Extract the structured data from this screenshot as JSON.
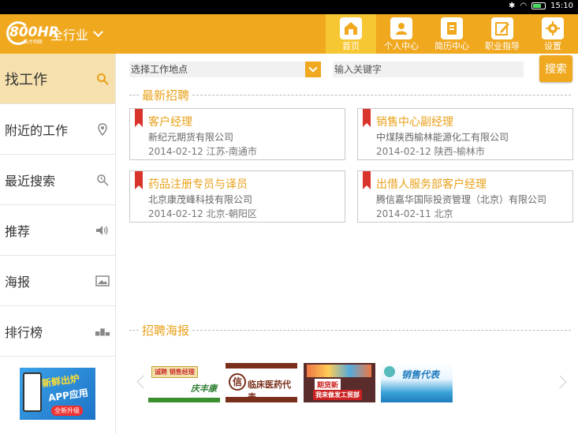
{
  "status": {
    "time": "15:10"
  },
  "header": {
    "logo_number": "800HR",
    "logo_sub": "英才网联",
    "industry": "全行业",
    "nav": [
      {
        "label": "首页",
        "icon": "home-icon"
      },
      {
        "label": "个人中心",
        "icon": "person-icon"
      },
      {
        "label": "简历中心",
        "icon": "resume-icon"
      },
      {
        "label": "职业指导",
        "icon": "edit-icon"
      },
      {
        "label": "设置",
        "icon": "gear-icon"
      }
    ]
  },
  "sidebar": {
    "items": [
      {
        "label": "找工作",
        "icon": "search-icon"
      },
      {
        "label": "附近的工作",
        "icon": "location-pin-icon"
      },
      {
        "label": "最近搜索",
        "icon": "recent-search-icon"
      },
      {
        "label": "推荐",
        "icon": "speaker-icon"
      },
      {
        "label": "海报",
        "icon": "poster-icon"
      },
      {
        "label": "排行榜",
        "icon": "podium-icon"
      }
    ],
    "ad": {
      "line1": "新鲜出炉",
      "line2": "APP应用",
      "badge": "全新升级"
    }
  },
  "search": {
    "location_label": "选择工作地点",
    "keyword_placeholder": "输入关键字",
    "button_label": "搜索"
  },
  "latest": {
    "title": "最新招聘",
    "jobs": [
      {
        "title": "客户经理",
        "company": "新纪元期货有限公司",
        "date": "2014-02-12",
        "location": "江苏-南通市"
      },
      {
        "title": "销售中心副经理",
        "company": "中煤陕西榆林能源化工有限公司",
        "date": "2014-02-12",
        "location": "陕西-榆林市"
      },
      {
        "title": "药品注册专员与译员",
        "company": "北京康茂峰科技有限公司",
        "date": "2014-02-12",
        "location": "北京-朝阳区"
      },
      {
        "title": "出借人服务部客户经理",
        "company": "腾信嘉华国际投资管理（北京）有限公司",
        "date": "2014-02-11",
        "location": "北京"
      }
    ]
  },
  "posters": {
    "title": "招聘海报",
    "items": [
      {
        "a": "诚聘 销售经理",
        "b": "庆丰康"
      },
      {
        "a": "信",
        "b": "临床医药代表"
      },
      {
        "b": "期货新",
        "c": "我来做发工贸部"
      },
      {
        "a": "销售代表"
      }
    ]
  },
  "colors": {
    "accent": "#f0a81f",
    "active_side": "#f6e0ad",
    "title_text": "#e8a11a"
  }
}
